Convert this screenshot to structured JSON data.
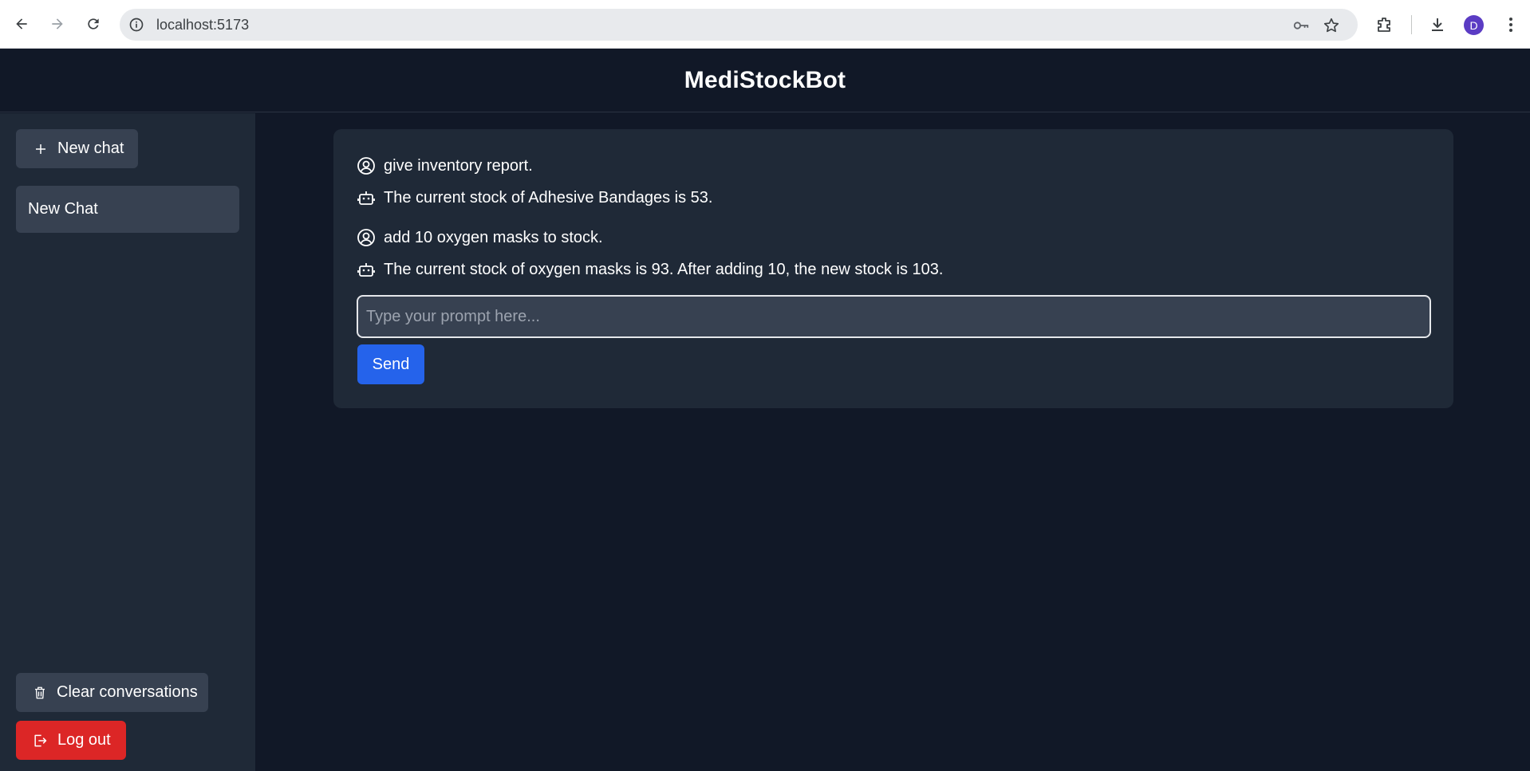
{
  "browser": {
    "url": "localhost:5173",
    "profile_initial": "D"
  },
  "app": {
    "title": "MediStockBot"
  },
  "sidebar": {
    "new_chat_label": "New chat",
    "chats": [
      {
        "title": "New Chat"
      }
    ],
    "clear_label": "Clear conversations",
    "logout_label": "Log out"
  },
  "conversation": {
    "messages": [
      {
        "role": "user",
        "icon": "user-circle-icon",
        "text": "give inventory report."
      },
      {
        "role": "bot",
        "icon": "robot-icon",
        "text": "The current stock of Adhesive Bandages is 53."
      },
      {
        "role": "user",
        "icon": "user-circle-icon",
        "text": "add 10 oxygen masks to stock."
      },
      {
        "role": "bot",
        "icon": "robot-icon",
        "text": "The current stock of oxygen masks is 93. After adding 10, the new stock is 103."
      }
    ],
    "input_placeholder": "Type your prompt here...",
    "input_value": "",
    "send_label": "Send"
  },
  "colors": {
    "background": "#111827",
    "panel": "#1f2937",
    "button_gray": "#374151",
    "send_blue": "#2563eb",
    "logout_red": "#dc2626"
  }
}
